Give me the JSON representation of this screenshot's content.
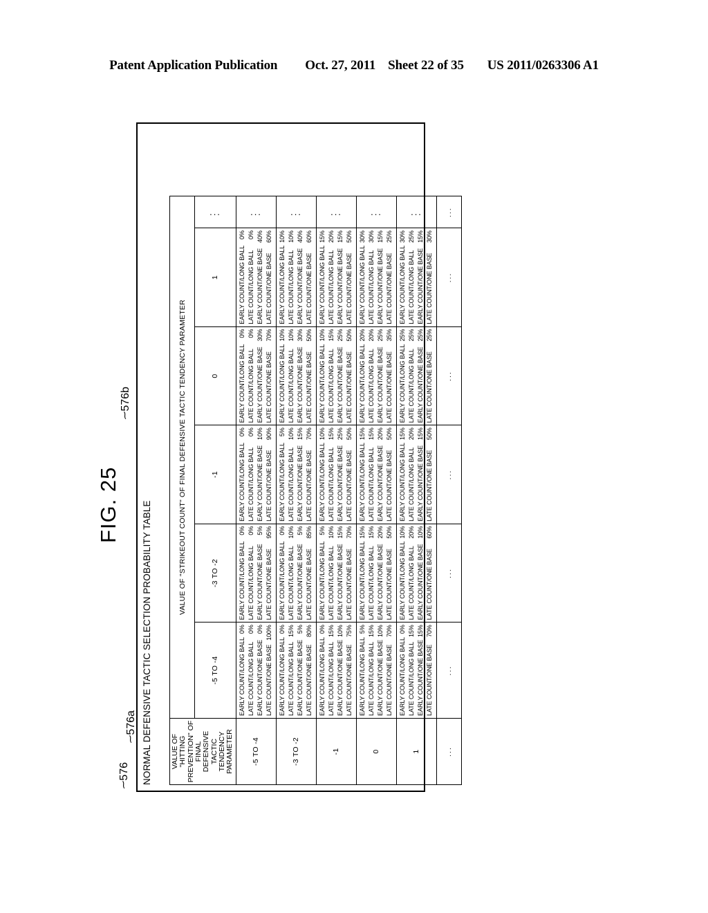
{
  "patent_header": {
    "publication": "Patent Application Publication",
    "date": "Oct. 27, 2011",
    "sheet": "Sheet 22 of 35",
    "number": "US 2011/0263306 A1"
  },
  "figure": {
    "label": "FIG. 25",
    "ref_table": "576",
    "ref_row_axis": "576a",
    "ref_col_axis": "576b",
    "title": "NORMAL DEFENSIVE TACTIC SELECTION PROBABILITY TABLE",
    "row_axis_header": "VALUE OF \"HITTING PREVENTION\" OF FINAL DEFENSIVE TACTIC TENDENCY PARAMETER",
    "col_axis_header": "VALUE OF \"STRIKEOUT COUNT\" OF FINAL DEFENSIVE TACTIC TENDENCY PARAMETER",
    "ellipsis": "...",
    "vertical_ellipsis": "..."
  },
  "chart_data": {
    "type": "table",
    "title": "NORMAL DEFENSIVE TACTIC SELECTION PROBABILITY TABLE",
    "row_axis_label": "VALUE OF \"HITTING PREVENTION\" OF FINAL DEFENSIVE TACTIC TENDENCY PARAMETER",
    "col_axis_label": "VALUE OF \"STRIKEOUT COUNT\" OF FINAL DEFENSIVE TACTIC TENDENCY PARAMETER",
    "row_categories": [
      "-5 TO -4",
      "-3 TO -2",
      "-1",
      "0",
      "1",
      "..."
    ],
    "col_categories": [
      "-5 TO -4",
      "-3 TO -2",
      "-1",
      "0",
      "1",
      "..."
    ],
    "tactics": [
      "EARLY COUNT/LONG BALL",
      "LATE COUNT/LONG BALL",
      "EARLY COUNT/ONE BASE",
      "LATE COUNT/ONE BASE"
    ],
    "cells": [
      [
        [
          "0%",
          "0%",
          "0%",
          "100%"
        ],
        [
          "0%",
          "0%",
          "5%",
          "95%"
        ],
        [
          "0%",
          "0%",
          "10%",
          "90%"
        ],
        [
          "0%",
          "0%",
          "30%",
          "70%"
        ],
        [
          "0%",
          "0%",
          "40%",
          "60%"
        ]
      ],
      [
        [
          "0%",
          "15%",
          "5%",
          "80%"
        ],
        [
          "0%",
          "10%",
          "5%",
          "85%"
        ],
        [
          "5%",
          "10%",
          "15%",
          "70%"
        ],
        [
          "10%",
          "10%",
          "30%",
          "50%"
        ],
        [
          "10%",
          "10%",
          "40%",
          "60%"
        ]
      ],
      [
        [
          "0%",
          "15%",
          "10%",
          "75%"
        ],
        [
          "5%",
          "10%",
          "15%",
          "70%"
        ],
        [
          "10%",
          "15%",
          "25%",
          "50%"
        ],
        [
          "10%",
          "15%",
          "25%",
          "50%"
        ],
        [
          "15%",
          "20%",
          "15%",
          "50%"
        ]
      ],
      [
        [
          "5%",
          "15%",
          "10%",
          "70%"
        ],
        [
          "15%",
          "15%",
          "20%",
          "50%"
        ],
        [
          "15%",
          "15%",
          "20%",
          "50%"
        ],
        [
          "20%",
          "20%",
          "25%",
          "35%"
        ],
        [
          "30%",
          "30%",
          "15%",
          "25%"
        ]
      ],
      [
        [
          "0%",
          "15%",
          "15%",
          "70%"
        ],
        [
          "10%",
          "20%",
          "10%",
          "60%"
        ],
        [
          "15%",
          "20%",
          "15%",
          "50%"
        ],
        [
          "25%",
          "25%",
          "25%",
          "25%"
        ],
        [
          "30%",
          "25%",
          "15%",
          "30%"
        ]
      ]
    ]
  }
}
